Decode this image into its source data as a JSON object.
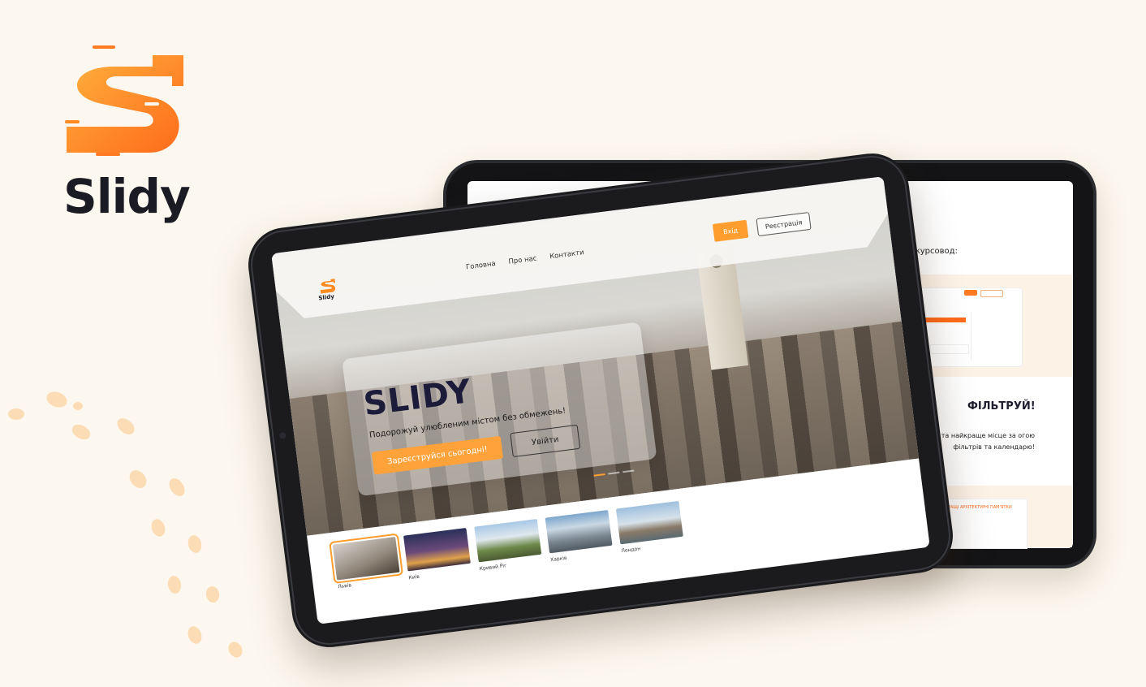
{
  "brand": {
    "name": "Slidy",
    "accent": "#ff8a1f"
  },
  "front": {
    "header": {
      "logo_text": "Slidy",
      "nav": [
        "Головна",
        "Про нас",
        "Контакти"
      ],
      "login_label": "Вхід",
      "register_label": "Реєстрація"
    },
    "hero": {
      "title": "SLIDY",
      "subtitle": "Подорожуй улюбленим містом без обмежень!",
      "signup_label": "Зареєструйся сьогодні!",
      "enter_label": "Увійти"
    },
    "cities": [
      {
        "label": "Львів",
        "active": true
      },
      {
        "label": "Київ",
        "active": false
      },
      {
        "label": "Кривий Ріг",
        "active": false
      },
      {
        "label": "Харків",
        "active": false
      },
      {
        "label": "Лондон",
        "active": false
      }
    ]
  },
  "back": {
    "guide_text": "екскурсовод:",
    "filter_title": "ФІЛЬТРУЙ!",
    "filter_desc": "ий час та найкраще місце за огою фільтрів та календарю!",
    "card_title": "РАЩІ АРХІТЕКТУРНІ ПАМ'ЯТКИ"
  }
}
